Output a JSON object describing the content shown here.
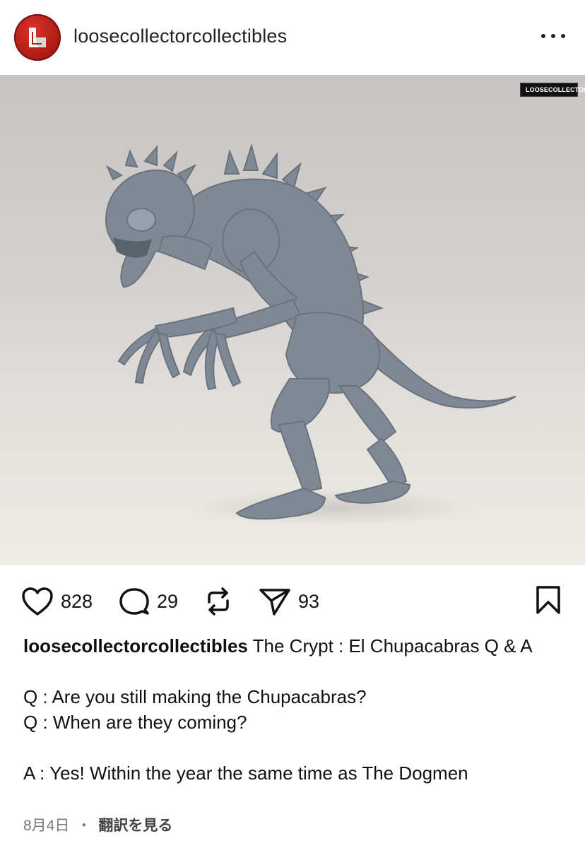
{
  "header": {
    "username": "loosecollectorcollectibles",
    "avatar_color": "#c0241b",
    "more_icon": "more-horizontal-icon"
  },
  "photo": {
    "watermark_text": "LOOSECOLLECTOR",
    "background_color": "#d0cdcb",
    "figure_color": "#7d8791"
  },
  "actions": {
    "like_count": "828",
    "comment_count": "29",
    "share_count": "93",
    "like_icon": "heart-icon",
    "comment_icon": "comment-icon",
    "repost_icon": "repost-icon",
    "send_icon": "send-icon",
    "bookmark_icon": "bookmark-icon"
  },
  "caption": {
    "username": "loosecollectorcollectibles",
    "title": " The Crypt : El Chupacabras Q & A",
    "line_q1": "Q : Are you still making the Chupacabras?",
    "line_q2": "Q : When are they coming?",
    "line_a": "A : Yes! Within the year the same time as The Dogmen"
  },
  "footer": {
    "date": "8月4日",
    "separator": "・",
    "translate": "翻訳を見る"
  }
}
